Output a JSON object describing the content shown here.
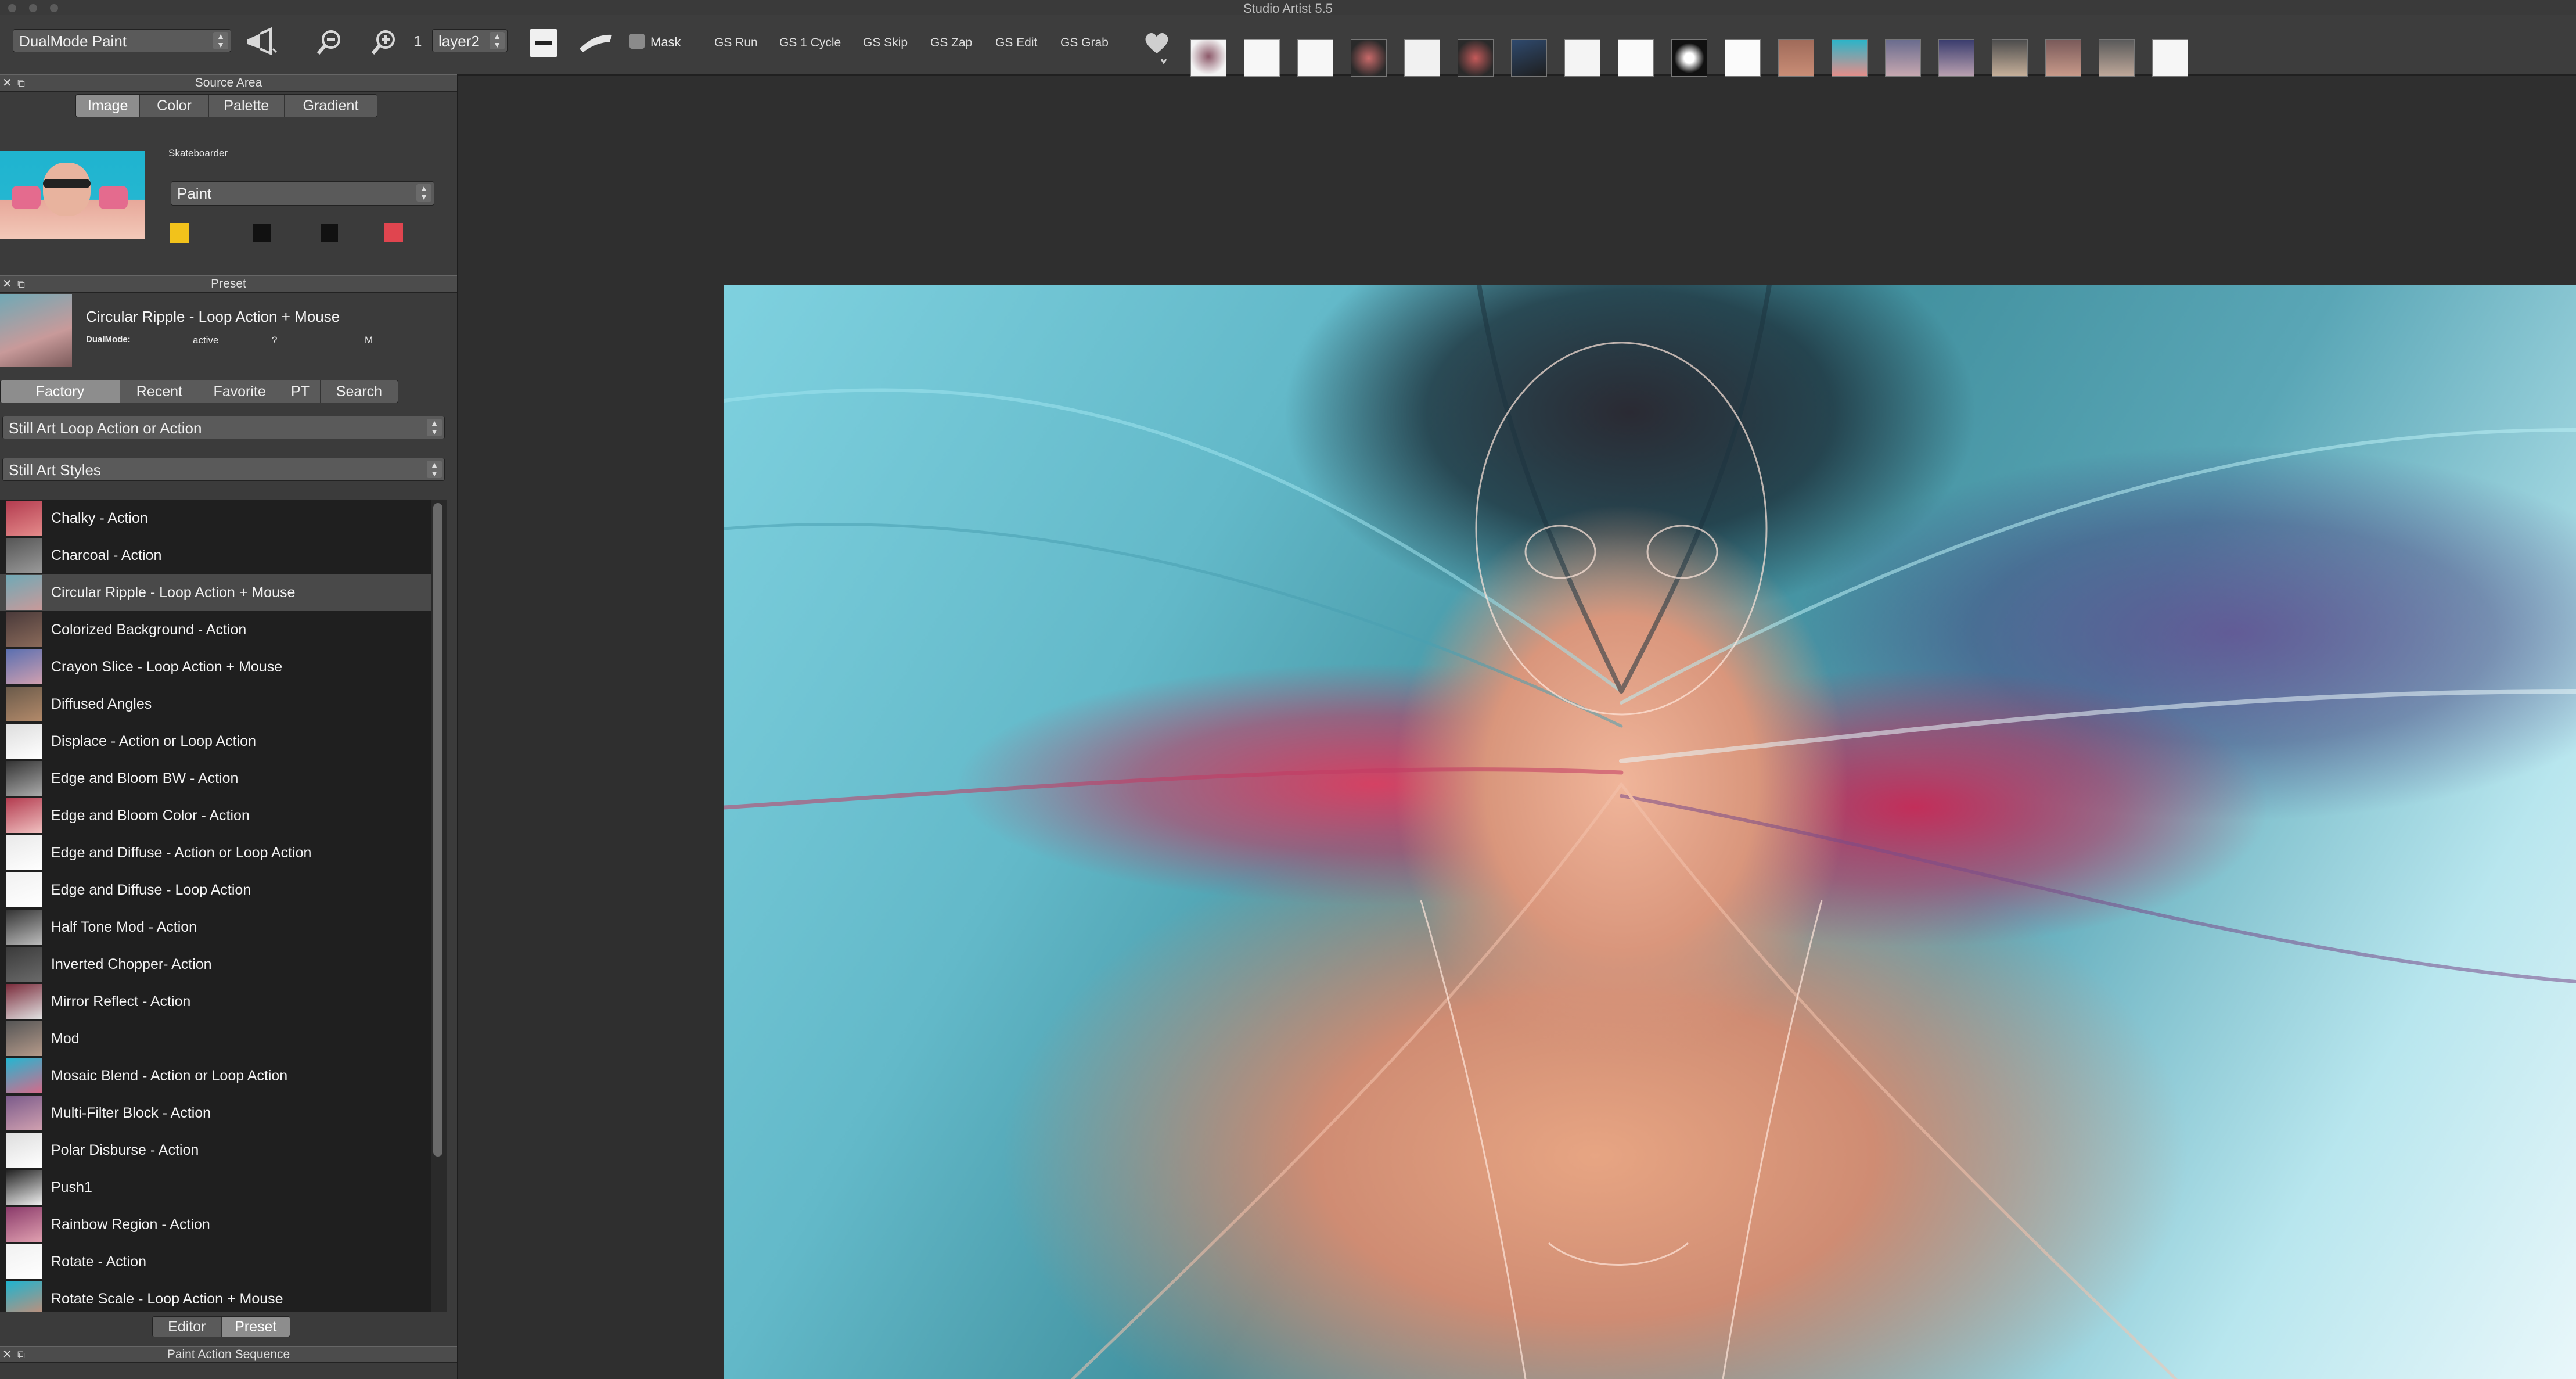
{
  "window": {
    "title": "Studio Artist 5.5"
  },
  "toolbar": {
    "mode_select": "DualMode Paint",
    "frame_number": "1",
    "layer_select": "layer2",
    "mask_label": "Mask",
    "gs_buttons": [
      "GS Run",
      "GS 1 Cycle",
      "GS Skip",
      "GS Zap",
      "GS Edit",
      "GS Grab"
    ],
    "icons": [
      "megaphone-icon",
      "zoom-out-icon",
      "zoom-in-icon",
      "brush-stroke-icon",
      "paint-brush-icon",
      "heart-icon"
    ]
  },
  "source_area": {
    "header": "Source Area",
    "tabs": [
      "Image",
      "Color",
      "Palette",
      "Gradient"
    ],
    "selected_tab": "Image",
    "image_name": "Skateboarder",
    "mode_select": "Paint",
    "swatch_colors": [
      "#f2c21b",
      "#111111",
      "#111111",
      "#e0454f"
    ]
  },
  "preset": {
    "header": "Preset",
    "current_name": "Circular Ripple - Loop Action + Mouse",
    "dualmode_label": "DualMode:",
    "dualmode_status": "active",
    "dualmode_q": "?",
    "dualmode_m": "M",
    "tabs": [
      "Factory",
      "Recent",
      "Favorite",
      "PT",
      "Search"
    ],
    "selected_tab": "Factory",
    "category_select": "Still Art Loop Action or Action",
    "style_select": "Still Art Styles",
    "items": [
      "Chalky - Action",
      "Charcoal - Action",
      "Circular Ripple - Loop Action + Mouse",
      "Colorized Background - Action",
      "Crayon Slice - Loop Action + Mouse",
      "Diffused Angles",
      "Displace - Action or Loop Action",
      "Edge and Bloom BW - Action",
      "Edge and Bloom Color - Action",
      "Edge and Diffuse - Action or Loop Action",
      "Edge and Diffuse - Loop Action",
      "Half Tone Mod - Action",
      "Inverted Chopper- Action",
      "Mirror Reflect - Action",
      "Mod",
      "Mosaic Blend - Action or Loop Action",
      "Multi-Filter Block - Action",
      "Polar Disburse - Action",
      "Push1",
      "Rainbow Region - Action",
      "Rotate - Action",
      "Rotate Scale - Loop Action + Mouse"
    ],
    "selected_index": 2,
    "bottom_tabs": [
      "Editor",
      "Preset"
    ],
    "bottom_selected": "Preset"
  },
  "paint_action_sequence": {
    "header": "Paint Action Sequence"
  }
}
